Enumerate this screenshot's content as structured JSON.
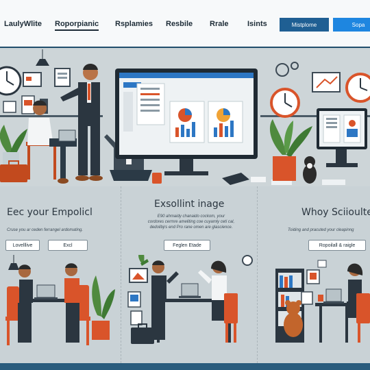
{
  "nav": {
    "brand": "LaulyWlite",
    "links": [
      "Roporpianic",
      "Rsplamies",
      "Resbile",
      "Rrale",
      "Isints"
    ],
    "btn_outline": "Mistplome",
    "btn_solid": "Sopa"
  },
  "sections": [
    {
      "title": "Eec your Empolicl",
      "text": "Cruse you ar ceden ferrangel ardomating.",
      "buttons": [
        "Lovelllive",
        "Excl"
      ]
    },
    {
      "title": "Exsollint inage",
      "text": [
        "E90 ahmaidy chanaido cockom, your",
        "cordores cermre ameliting coe cuyamly ceti cal,",
        "dedolibjrs end Pro rane omen are glascience."
      ],
      "buttons": [
        "Feglen Etade"
      ]
    },
    {
      "title": "Whoy Sciioulte",
      "text": "Toiding and pracuted your cleapinng",
      "buttons": [
        "Ropoilall & raigle"
      ]
    }
  ],
  "colors": {
    "nav_dark": "#1f5f93",
    "nav_blue": "#1e86e0",
    "accent_orange": "#d9542a",
    "background": "#c9d2d6"
  }
}
